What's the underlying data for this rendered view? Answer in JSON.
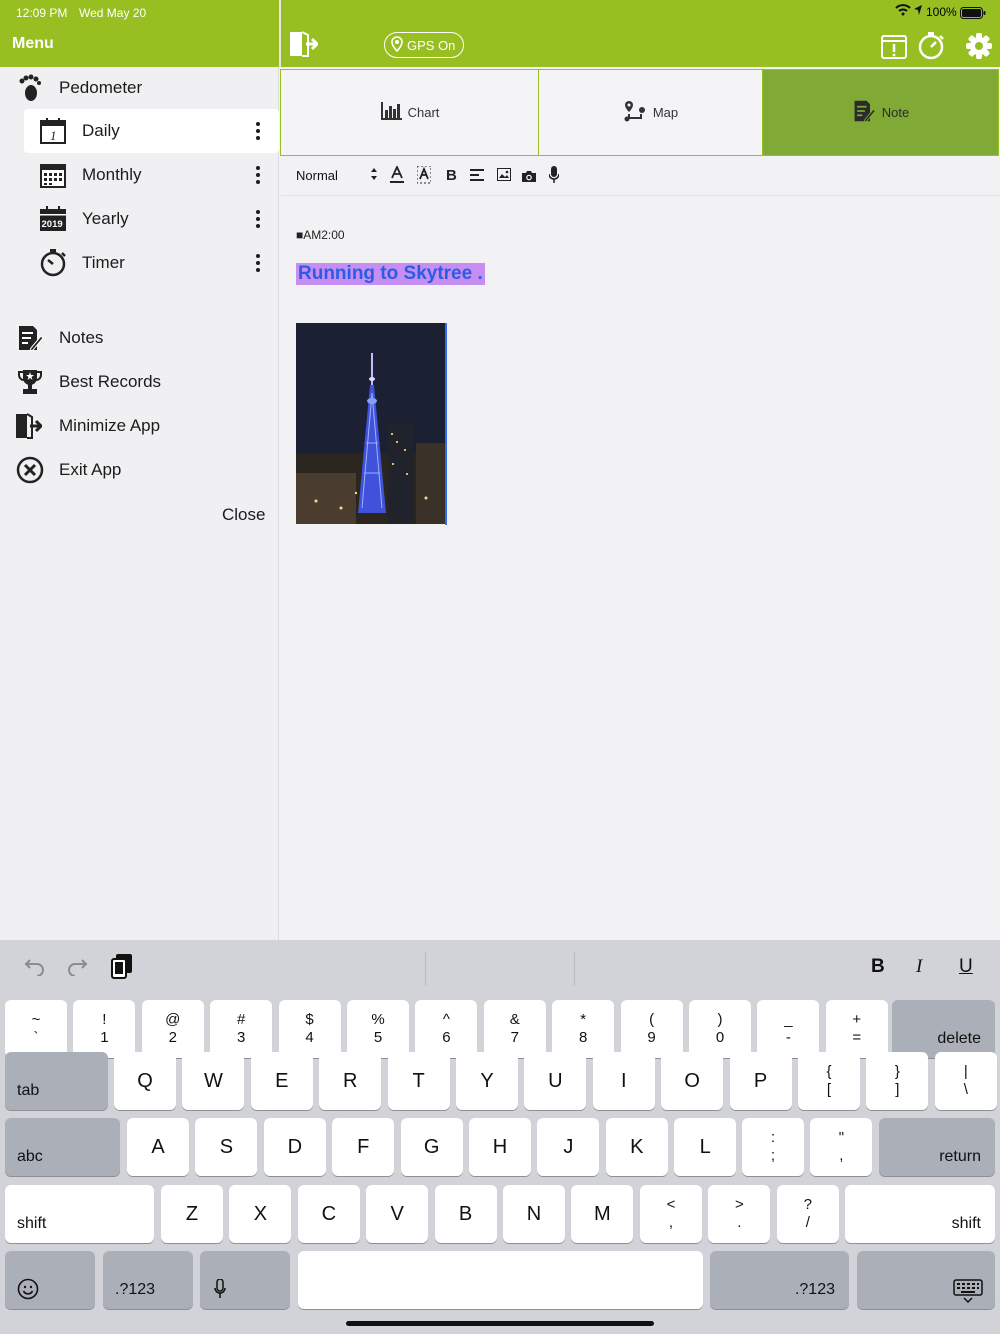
{
  "status_bar": {
    "time": "12:09 PM",
    "date": "Wed May 20",
    "battery": "100%"
  },
  "sidebar": {
    "title": "Menu",
    "items": [
      {
        "label": "Pedometer",
        "icon": "footprints-icon"
      },
      {
        "label": "Daily",
        "icon": "calendar-day-icon",
        "selected": true
      },
      {
        "label": "Monthly",
        "icon": "calendar-month-icon"
      },
      {
        "label": "Yearly",
        "icon": "calendar-year-icon",
        "badge": "2019"
      },
      {
        "label": "Timer",
        "icon": "stopwatch-icon"
      },
      {
        "label": "Notes",
        "icon": "notes-icon"
      },
      {
        "label": "Best Records",
        "icon": "trophy-icon"
      },
      {
        "label": "Minimize App",
        "icon": "door-exit-icon"
      },
      {
        "label": "Exit App",
        "icon": "close-circle-icon"
      }
    ],
    "close_label": "Close"
  },
  "header": {
    "gps_label": "GPS On"
  },
  "tabs": [
    {
      "label": "Chart",
      "icon": "bar-chart-icon"
    },
    {
      "label": "Map",
      "icon": "map-route-icon"
    },
    {
      "label": "Note",
      "icon": "note-edit-icon",
      "active": true
    }
  ],
  "toolbar": {
    "format_select": "Normal"
  },
  "note": {
    "timestamp": "■AM2:00",
    "headline": "Running to Skytree ."
  },
  "keyboard": {
    "number_row": [
      [
        "~",
        "`"
      ],
      [
        "!",
        "1"
      ],
      [
        "@",
        "2"
      ],
      [
        "#",
        "3"
      ],
      [
        "$",
        "4"
      ],
      [
        "%",
        "5"
      ],
      [
        "^",
        "6"
      ],
      [
        "&",
        "7"
      ],
      [
        "*",
        "8"
      ],
      [
        "(",
        "9"
      ],
      [
        ")",
        "0"
      ],
      [
        "_",
        "-"
      ],
      [
        "+",
        "="
      ]
    ],
    "delete": "delete",
    "tab": "tab",
    "row_q": [
      "Q",
      "W",
      "E",
      "R",
      "T",
      "Y",
      "U",
      "I",
      "O",
      "P"
    ],
    "row_q_extra": [
      [
        "{",
        "["
      ],
      [
        "}",
        "]"
      ],
      [
        "|",
        "\\"
      ]
    ],
    "abc": "abc",
    "row_a": [
      "A",
      "S",
      "D",
      "F",
      "G",
      "H",
      "J",
      "K",
      "L"
    ],
    "row_a_extra": [
      [
        ":",
        ";"
      ],
      [
        "\"",
        ","
      ]
    ],
    "return": "return",
    "shift": "shift",
    "row_z": [
      "Z",
      "X",
      "C",
      "V",
      "B",
      "N",
      "M"
    ],
    "row_z_extra": [
      [
        "<",
        ","
      ],
      [
        ">",
        "."
      ],
      [
        "?",
        "/"
      ]
    ],
    "numbers_key": ".?123",
    "format_bold": "B",
    "format_italic": "I",
    "format_underline": "U"
  },
  "colors": {
    "brand_green": "#97bf22",
    "tab_active": "#80a935",
    "highlight": "#c58ef0",
    "headline_text": "#2b5ce6"
  }
}
